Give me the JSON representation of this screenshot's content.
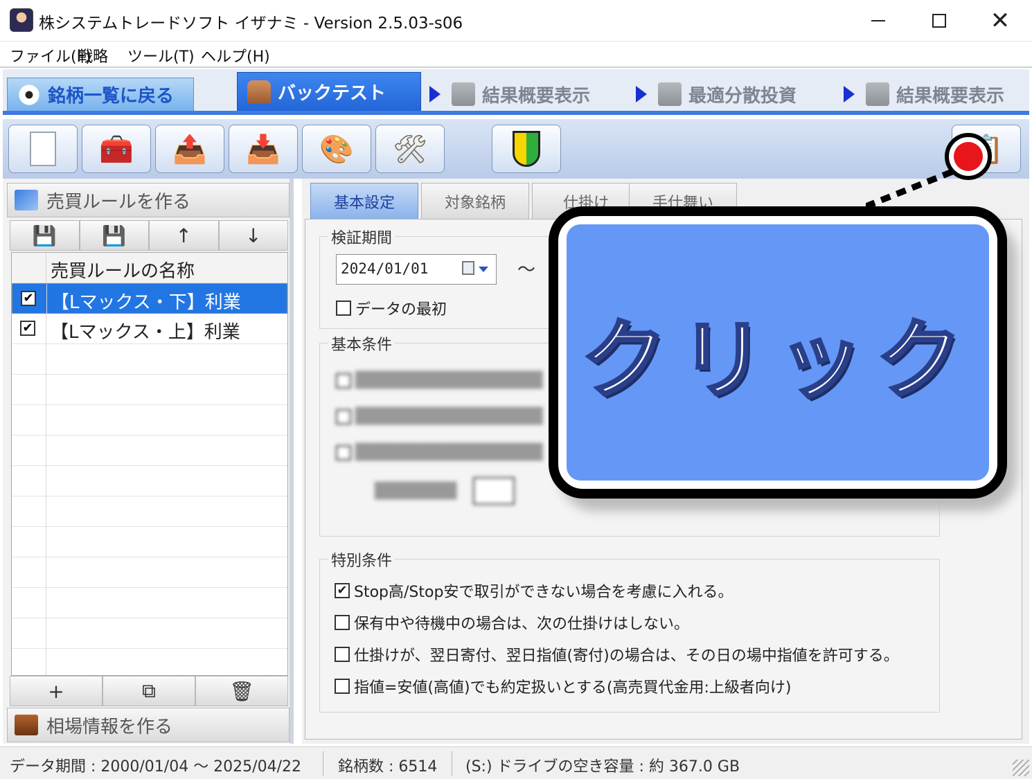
{
  "window": {
    "title": "株システムトレードソフト イザナミ - Version 2.5.03-s06",
    "close_glyph": "✕"
  },
  "menu": [
    "ファイル(F)",
    "戦略",
    "ツール(T)",
    "ヘルプ(H)"
  ],
  "mode_tabs": {
    "back": "銘柄一覧に戻る",
    "backtest": "バックテスト",
    "summary1": "結果概要表示",
    "optimal": "最適分散投資",
    "summary2": "結果概要表示"
  },
  "toolbar": {
    "icons": [
      "new-document-icon",
      "toolbox-icon",
      "export-icon",
      "import-icon",
      "palette-icon",
      "tools-icon",
      "beginner-mark-icon",
      "settings-icon"
    ]
  },
  "left_panel": {
    "rules_header": "売買ルールを作る",
    "rule_toolbar_icons": [
      "save-icon",
      "save-as-icon",
      "arrow-up-icon",
      "arrow-down-icon"
    ],
    "table_header": "売買ルールの名称",
    "rules": [
      {
        "name": "【Lマックス・下】利業",
        "checked": true,
        "selected": true
      },
      {
        "name": "【Lマックス・上】利業",
        "checked": true,
        "selected": false
      }
    ],
    "foot_labels": {
      "add": "+",
      "delete": "🗑"
    },
    "market_header": "相場情報を作る"
  },
  "right_panel": {
    "tabs": [
      "基本設定",
      "対象銘柄",
      "仕掛け",
      "手仕舞い"
    ],
    "active_tab": "基本設定",
    "verification_period": {
      "title": "検証期間",
      "start_date": "2024/01/01",
      "tilde": "〜",
      "from_start_label": "データの最初"
    },
    "basic_conditions": {
      "title": "基本条件"
    },
    "special_conditions": {
      "title": "特別条件",
      "options": [
        {
          "label": "Stop高/Stop安で取引ができない場合を考慮に入れる。",
          "checked": true
        },
        {
          "label": "保有中や待機中の場合は、次の仕掛けはしない。",
          "checked": false
        },
        {
          "label": "仕掛けが、翌日寄付、翌日指値(寄付)の場合は、その日の場中指値を許可する。",
          "checked": false
        },
        {
          "label": "指値=安値(高値)でも約定扱いとする(高売買代金用:上級者向け)",
          "checked": false
        }
      ]
    }
  },
  "overlay": {
    "callout_text": "クリック",
    "marker_color": "#e8151b",
    "callout_color": "#6598f6"
  },
  "status": {
    "data_period": "データ期間 : 2000/01/04 〜 2025/04/22",
    "stock_count": "銘柄数 : 6514",
    "drive_space": "(S:) ドライブの空き容量 : 約 367.0 GB"
  }
}
